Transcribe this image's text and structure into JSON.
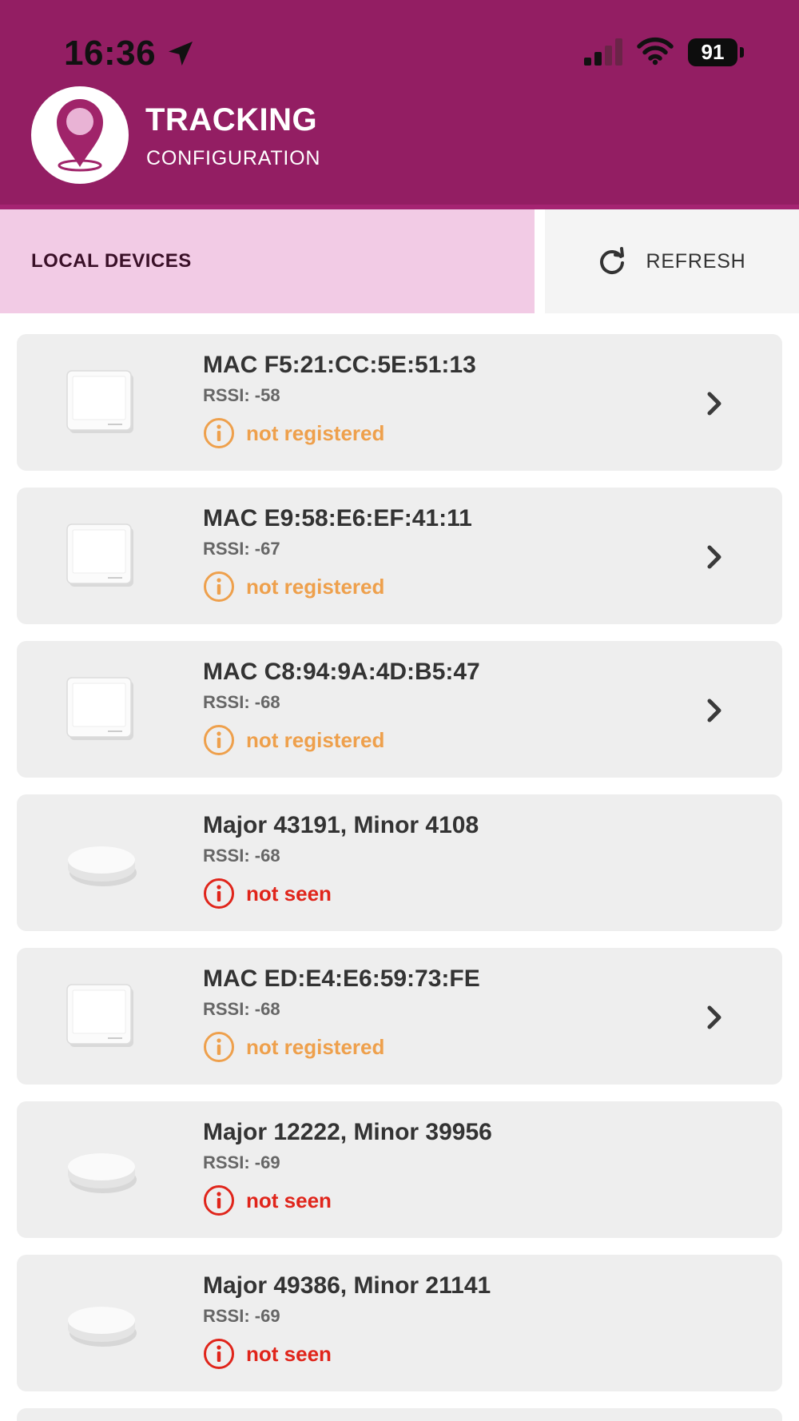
{
  "status_bar": {
    "time": "16:36",
    "battery": "91"
  },
  "header": {
    "title": "TRACKING",
    "subtitle": "CONFIGURATION"
  },
  "tabs": {
    "local_label": "LOCAL DEVICES",
    "refresh_label": "REFRESH"
  },
  "devices": [
    {
      "name": "MAC F5:21:CC:5E:51:13",
      "rssi": "RSSI: -58",
      "status": "not registered",
      "kind": "panel",
      "status_color": "#eea04c",
      "has_chevron": true
    },
    {
      "name": "MAC E9:58:E6:EF:41:11",
      "rssi": "RSSI: -67",
      "status": "not registered",
      "kind": "panel",
      "status_color": "#eea04c",
      "has_chevron": true
    },
    {
      "name": "MAC C8:94:9A:4D:B5:47",
      "rssi": "RSSI: -68",
      "status": "not registered",
      "kind": "panel",
      "status_color": "#eea04c",
      "has_chevron": true
    },
    {
      "name": "Major 43191, Minor 4108",
      "rssi": "RSSI: -68",
      "status": "not seen",
      "kind": "puck",
      "status_color": "#e0251b",
      "has_chevron": false
    },
    {
      "name": "MAC ED:E4:E6:59:73:FE",
      "rssi": "RSSI: -68",
      "status": "not registered",
      "kind": "panel",
      "status_color": "#eea04c",
      "has_chevron": true
    },
    {
      "name": "Major 12222, Minor 39956",
      "rssi": "RSSI: -69",
      "status": "not seen",
      "kind": "puck",
      "status_color": "#e0251b",
      "has_chevron": false
    },
    {
      "name": "Major 49386, Minor 21141",
      "rssi": "RSSI: -69",
      "status": "not seen",
      "kind": "puck",
      "status_color": "#e0251b",
      "has_chevron": false
    }
  ],
  "colors": {
    "header": "#931e63",
    "tab_active": "#f2cbe5",
    "warning": "#eea04c",
    "error": "#e0251b"
  },
  "icons": {
    "location": "location-arrow-icon",
    "signal": "cellular-signal-icon",
    "wifi": "wifi-icon",
    "refresh": "refresh-icon",
    "info": "info-circle-icon",
    "chevron": "chevron-right-icon",
    "logo": "map-pin-icon"
  }
}
